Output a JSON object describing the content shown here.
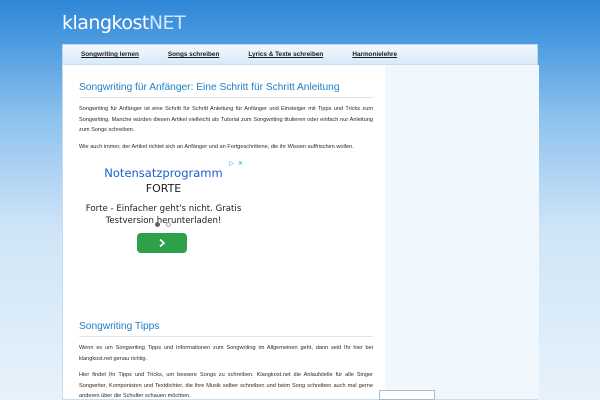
{
  "logo": {
    "part1": "klangkost",
    "part2": "NET"
  },
  "nav": {
    "items": [
      {
        "label": "Songwriting lernen"
      },
      {
        "label": "Songs schreiben"
      },
      {
        "label": "Lyrics & Texte schreiben"
      },
      {
        "label": "Harmonielehre"
      }
    ]
  },
  "article": {
    "title": "Songwriting für Anfänger: Eine Schritt für Schritt Anleitung",
    "paragraph1": "Songwriting für Anfänger ist eine Schritt für Schritt Anleitung für Anfänger und Einsteiger mit Tipps und Tricks zum Songwriting. Manche würden diesen Artikel vielleicht als Tutorial zum Songwriting titulieren oder einfach nur Anleitung zum Songs schreiben.",
    "paragraph2": "Wie auch immer, der Artikel richtet sich an Anfänger und an Fortgeschrittene, die ihr Wissen auffrischen wollen."
  },
  "ad": {
    "title": "Notensatzprogramm",
    "brand": "FORTE",
    "text": "Forte - Einfacher geht's nicht. Gratis Testversion herunterladen!",
    "accent_color": "#2ea04a"
  },
  "section2": {
    "title": "Songwriting Tipps",
    "paragraph1": "Wenn es um Songwriting Tipps und Informationen zum Songwriting im Allgemeinen geht, dann seid Ihr hier bei klangkost.net genau richtig.",
    "paragraph2": "Hier findet Ihr Tipps und Tricks, um bessere Songs zu schreiben. Klangkost.net die Anlaufstelle für alle Singer Songwriter, Komponisten und Textdichter, die ihre Musik selber schreiben und beim Song schreiben auch mal gerne anderen über die Schulter schauen möchten."
  }
}
